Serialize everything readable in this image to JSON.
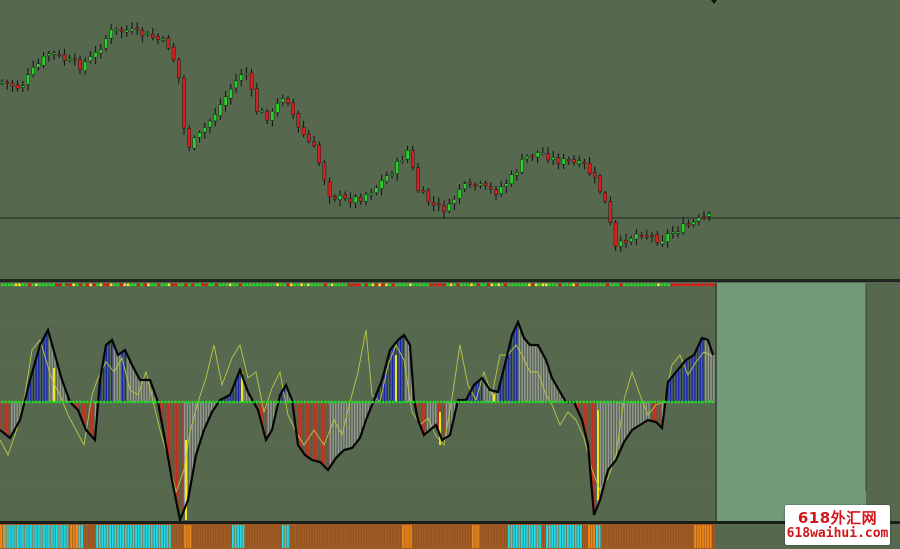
{
  "colors": {
    "background": "#56694f",
    "bull_candle": "#2ad12a",
    "bear_candle": "#d42020",
    "wick": "#101010",
    "hist_pos": "#1525b0",
    "hist_neg": "#c82a1a",
    "hist_neutral": "#9a9a9a",
    "signal_yellow": "#f5e619",
    "main_line": "#050505",
    "thin_line": "#b8c846",
    "dot_green": "#22dd22",
    "dot_red": "#ee1111",
    "dot_yellow": "#f2ee22",
    "bar_cyan": "#22dcea",
    "bar_brown": "#a15b24",
    "bar_orange": "#f08818",
    "future_panel": "#729a79"
  },
  "watermark": {
    "line1": "618外汇网",
    "line2": "618waihui.com"
  },
  "panels": {
    "price_panel": "candlestick",
    "oscillator_panel": "histogram",
    "signal_strip": "color-bar"
  }
}
